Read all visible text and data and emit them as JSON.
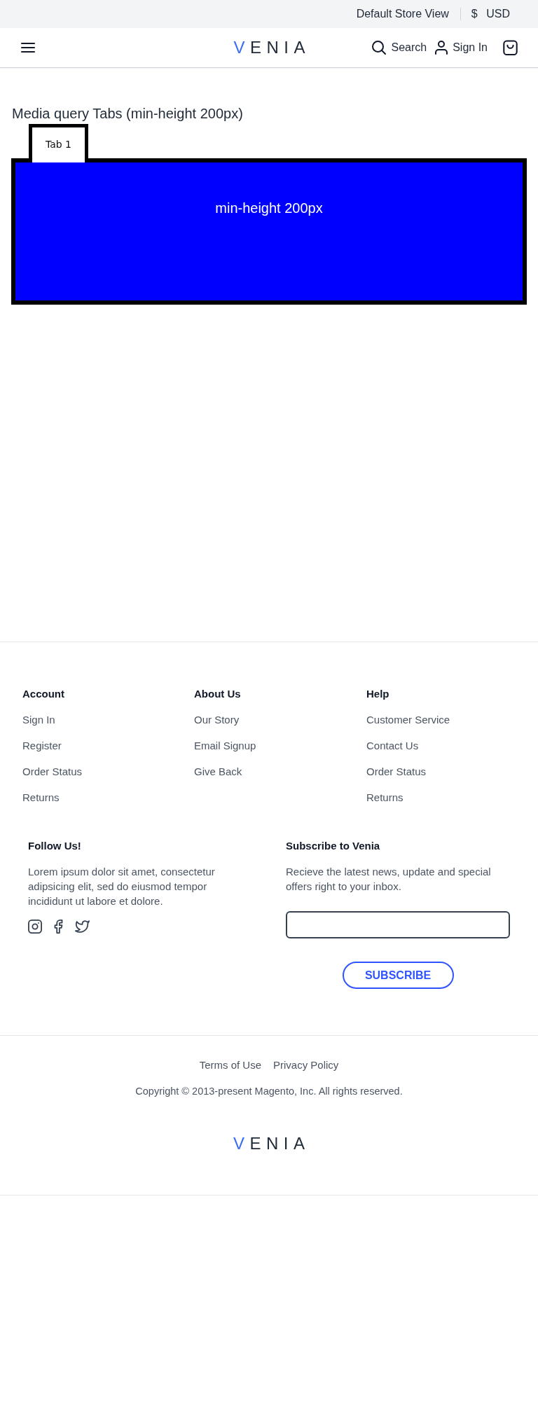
{
  "store_bar": {
    "store_view": "Default Store View",
    "currency": {
      "symbol": "$",
      "code": "USD"
    }
  },
  "header": {
    "logo": "VENIA",
    "search": "Search",
    "sign_in": "Sign In"
  },
  "main": {
    "title": "Media query Tabs (min-height 200px)",
    "tabs": [
      {
        "label": "Tab 1",
        "selected": true
      }
    ],
    "panel_text": "min-height 200px"
  },
  "footer": {
    "columns": [
      {
        "heading": "Account",
        "links": [
          "Sign In",
          "Register",
          "Order Status",
          "Returns"
        ]
      },
      {
        "heading": "About Us",
        "links": [
          "Our Story",
          "Email Signup",
          "Give Back"
        ]
      },
      {
        "heading": "Help",
        "links": [
          "Customer Service",
          "Contact Us",
          "Order Status",
          "Returns"
        ]
      }
    ],
    "follow": {
      "heading": "Follow Us!",
      "text": "Lorem ipsum dolor sit amet, consectetur adipsicing elit, sed do eiusmod tempor incididunt ut labore et dolore."
    },
    "subscribe": {
      "heading": "Subscribe to Venia",
      "text": "Recieve the latest news, update and special offers right to your inbox.",
      "button": "SUBSCRIBE"
    },
    "legal_links": [
      "Terms of Use",
      "Privacy Policy"
    ],
    "copyright": "Copyright © 2013-present Magento, Inc. All rights reserved.",
    "logo": "VENIA"
  }
}
